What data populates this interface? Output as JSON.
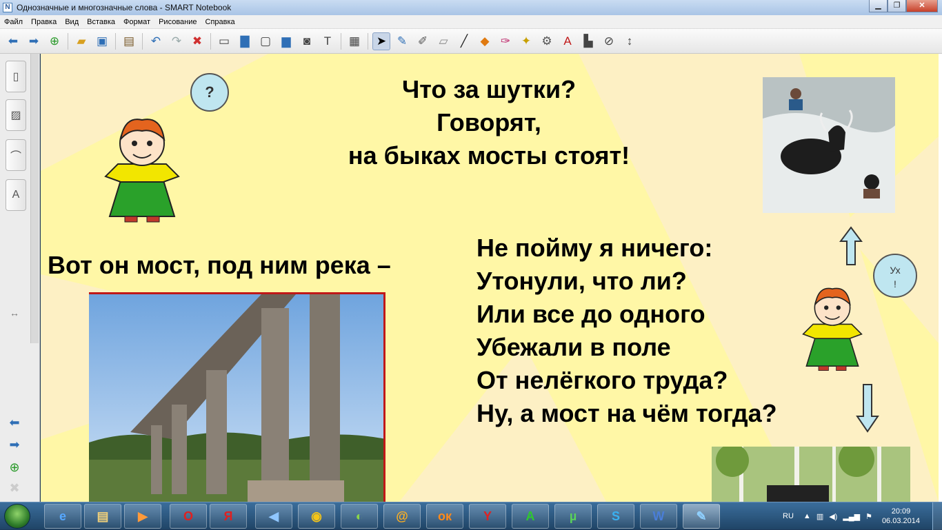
{
  "window": {
    "title": "Однозначные и многозначные слова - SMART Notebook",
    "buttons": {
      "minimize": "▁",
      "maximize": "❐",
      "close": "✕"
    }
  },
  "menu": [
    "Файл",
    "Правка",
    "Вид",
    "Вставка",
    "Формат",
    "Рисование",
    "Справка"
  ],
  "toolbar": {
    "icons": [
      "back-icon",
      "forward-icon",
      "add-page-icon",
      "open-file-icon",
      "save-icon",
      "paste-icon",
      "undo-icon",
      "redo-icon",
      "delete-icon",
      "screen-shade-icon",
      "full-screen-icon",
      "dual-display-icon",
      "capture-icon",
      "document-camera-icon",
      "table-icon",
      "select-icon",
      "pen-icon",
      "creative-pen-icon",
      "eraser-icon",
      "line-icon",
      "shapes-icon",
      "magic-pen-icon",
      "fill-icon",
      "properties-icon",
      "text-icon",
      "handwriting-icon",
      "measure-icon",
      "move-toolbar-icon"
    ]
  },
  "slide": {
    "heading": [
      "Что за шутки?",
      "Говорят,",
      "на быках мосты стоят!"
    ],
    "bridge_caption": "Вот он мост, под ним река –",
    "poem": [
      "Не пойму я ничего:",
      "Утонули, что ли?",
      "Или все до одного",
      "Убежали в поле",
      "От нелёгкого труда?",
      "Ну, а мост на чём тогда?"
    ],
    "bubble_left": "?",
    "bubble_right_line1": "Ух",
    "bubble_right_line2": "!",
    "colors": {
      "background": "#fff7a6",
      "rays": "#fdf0c4",
      "bubble": "#bfe6f0",
      "arrow": "#bfe6f0",
      "shirt": "#f2e600",
      "pants": "#2aa12a",
      "hair": "#e4641e"
    }
  },
  "taskbar": {
    "apps": [
      "internet-explorer-icon",
      "explorer-icon",
      "media-player-icon",
      "opera-icon",
      "yandex-icon",
      "sound-icon",
      "chrome-icon",
      "app-icon",
      "mail-agent-icon",
      "odnoklassniki-icon",
      "yandex-browser-icon",
      "acrobat-icon",
      "utorrent-icon",
      "skype-icon",
      "word-icon",
      "notebook-icon"
    ],
    "lang": "RU",
    "time": "20:09",
    "date": "06.03.2014"
  }
}
